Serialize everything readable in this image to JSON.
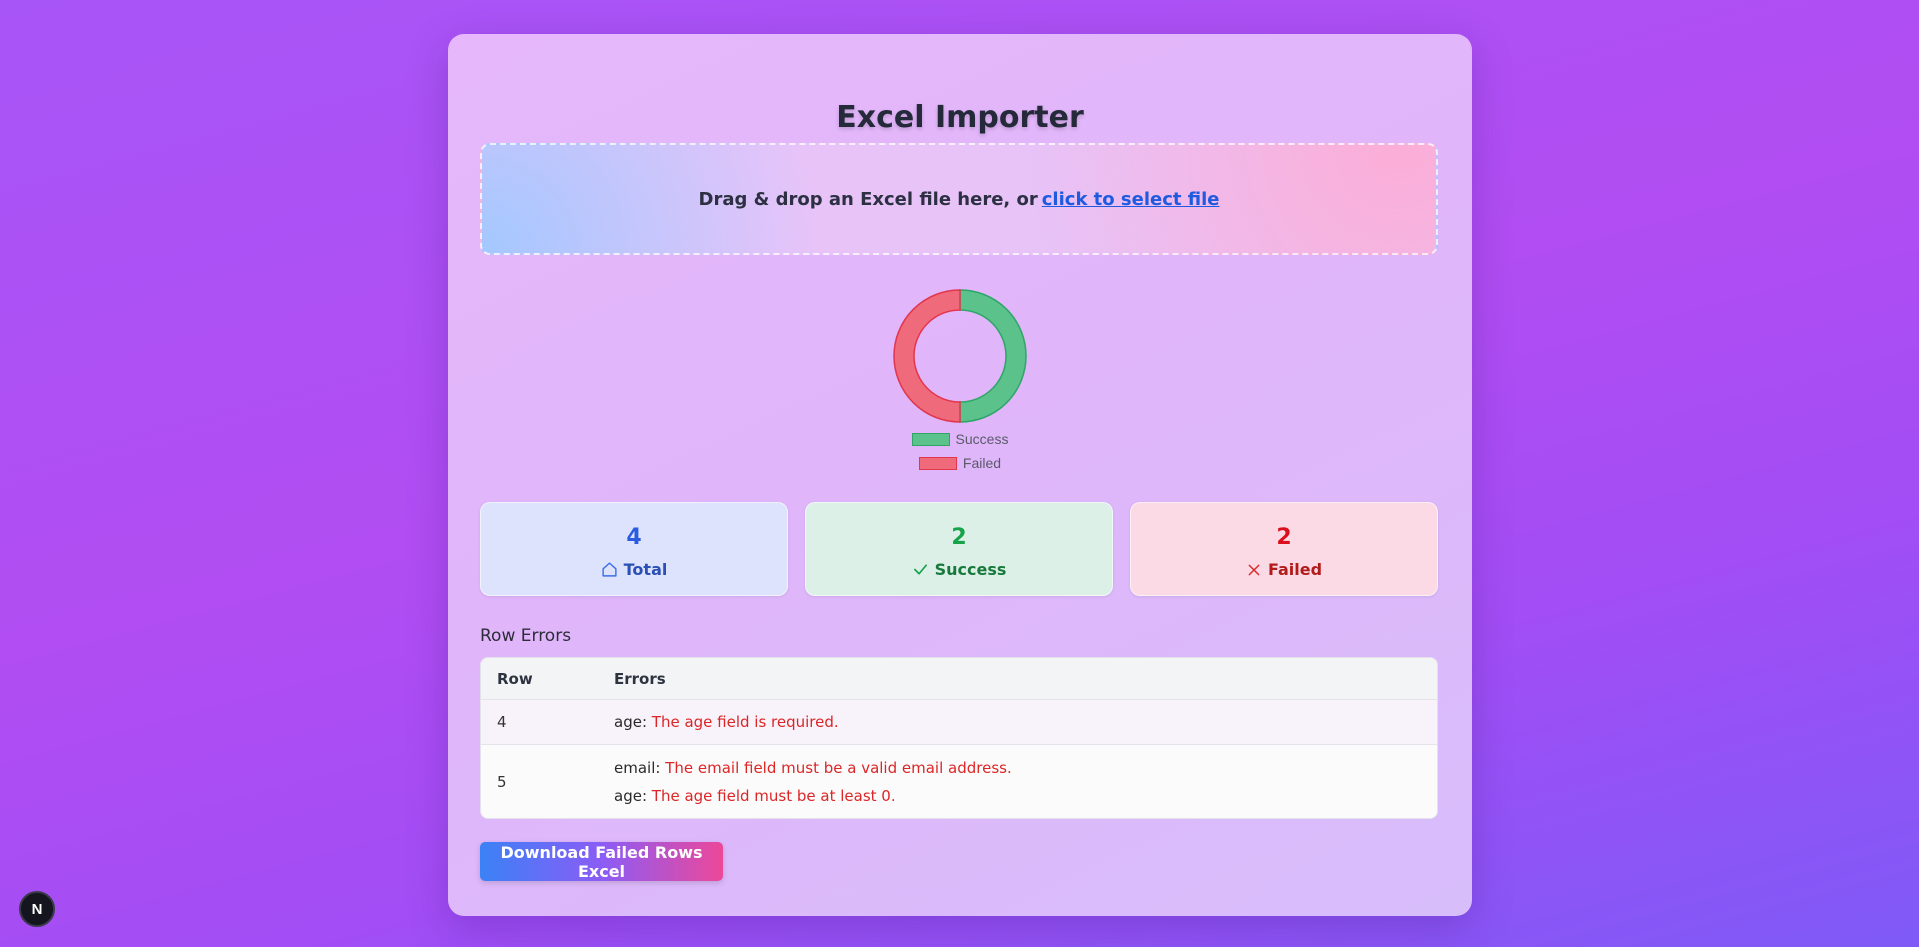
{
  "title": "Excel Importer",
  "dropzone": {
    "prefix": "Drag & drop an Excel file here, or",
    "link": "click to select file"
  },
  "chart_data": {
    "type": "pie",
    "categories": [
      "Success",
      "Failed"
    ],
    "values": [
      2,
      2
    ],
    "colors": [
      "#5ac28a",
      "#ef6a7a"
    ],
    "legend_position": "bottom"
  },
  "legend": [
    {
      "label": "Success",
      "fill": "#5ac28a",
      "stroke": "#2fa668"
    },
    {
      "label": "Failed",
      "fill": "#ef6a7a",
      "stroke": "#e2364c"
    }
  ],
  "stats": {
    "total": {
      "value": "4",
      "label": "Total",
      "icon": "home-icon"
    },
    "success": {
      "value": "2",
      "label": "Success",
      "icon": "check-icon"
    },
    "failed": {
      "value": "2",
      "label": "Failed",
      "icon": "x-icon"
    }
  },
  "errors_section": {
    "title": "Row Errors",
    "headers": [
      "Row",
      "Errors"
    ],
    "rows": [
      {
        "row": "4",
        "errors": [
          {
            "field": "age:",
            "message": "The age field is required."
          }
        ]
      },
      {
        "row": "5",
        "errors": [
          {
            "field": "email:",
            "message": "The email field must be a valid email address."
          },
          {
            "field": "age:",
            "message": "The age field must be at least 0."
          }
        ]
      }
    ]
  },
  "download_button": "Download Failed Rows Excel",
  "badge": "N",
  "colors": {
    "accent_blue": "#3b82f6",
    "accent_pink": "#ec4899",
    "error_red": "#dc2626",
    "success_green": "#16a34a"
  }
}
